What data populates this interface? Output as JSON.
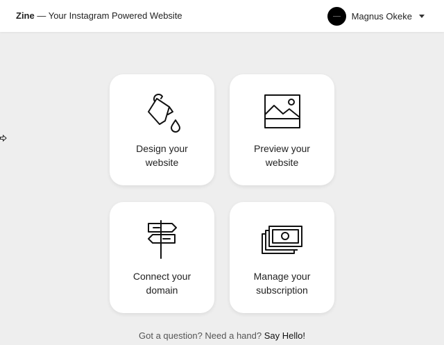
{
  "header": {
    "brand_name": "Zine",
    "brand_tagline": " — Your Instagram Powered Website",
    "user_name": "Magnus Okeke"
  },
  "cards": [
    {
      "line1": "Design your",
      "line2": "website",
      "icon": "paint-pour-icon"
    },
    {
      "line1": "Preview your",
      "line2": "website",
      "icon": "image-icon"
    },
    {
      "line1": "Connect your",
      "line2": "domain",
      "icon": "signpost-icon"
    },
    {
      "line1": "Manage your",
      "line2": "subscription",
      "icon": "money-stack-icon"
    }
  ],
  "footer": {
    "question": "Got a question? Need a hand? ",
    "link": "Say Hello!"
  },
  "colors": {
    "background": "#eeeeee",
    "card": "#ffffff",
    "text": "#222222"
  }
}
